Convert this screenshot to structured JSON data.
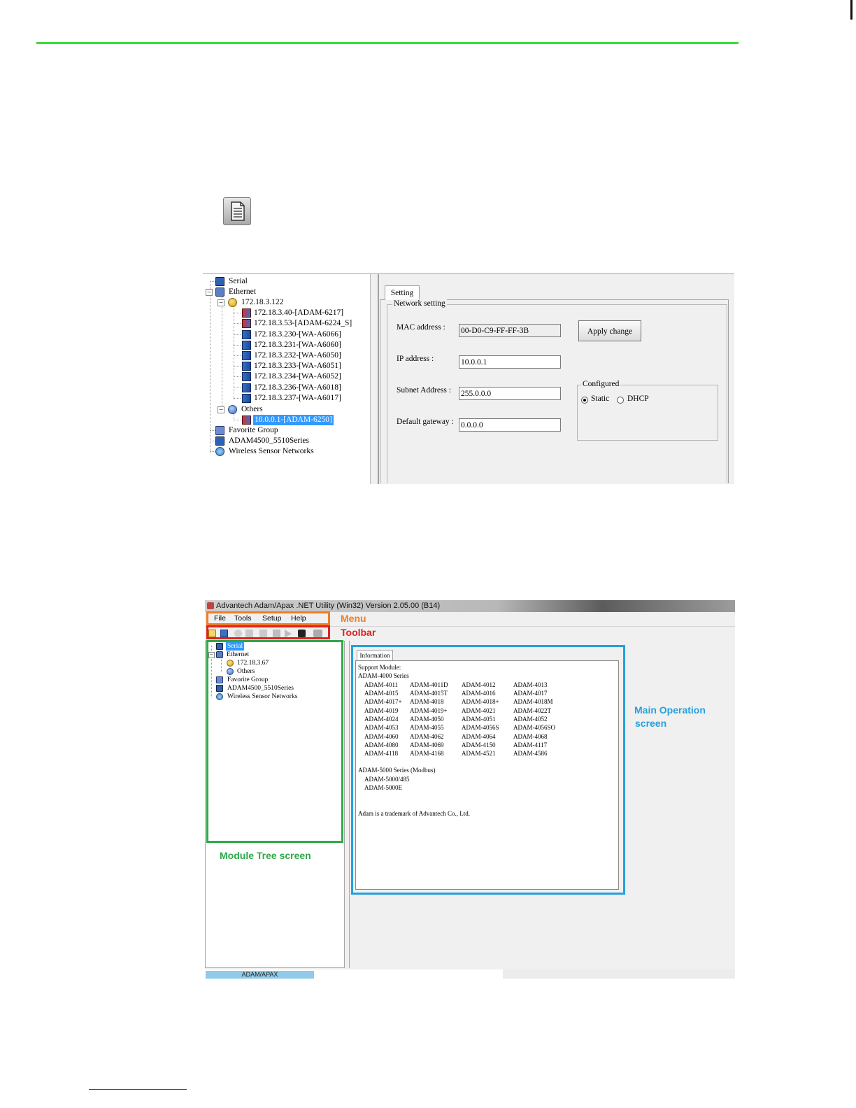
{
  "screenshot1": {
    "tree": [
      {
        "label": "Serial",
        "icon": "serial-pc-icon"
      },
      {
        "label": "Ethernet",
        "icon": "ethernet-icon"
      },
      {
        "label": "172.18.3.122",
        "icon": "subnet-globe-icon"
      },
      {
        "label": "172.18.3.40-[ADAM-6217]",
        "icon": "adam-module-icon"
      },
      {
        "label": "172.18.3.53-[ADAM-6224_S]",
        "icon": "adam-module-icon"
      },
      {
        "label": "172.18.3.230-[WA-A6066]",
        "icon": "wa-module-icon"
      },
      {
        "label": "172.18.3.231-[WA-A6060]",
        "icon": "wa-module-icon"
      },
      {
        "label": "172.18.3.232-[WA-A6050]",
        "icon": "wa-module-icon"
      },
      {
        "label": "172.18.3.233-[WA-A6051]",
        "icon": "wa-module-icon"
      },
      {
        "label": "172.18.3.234-[WA-A6052]",
        "icon": "wa-module-icon"
      },
      {
        "label": "172.18.3.236-[WA-A6018]",
        "icon": "wa-module-icon"
      },
      {
        "label": "172.18.3.237-[WA-A6017]",
        "icon": "wa-module-icon"
      },
      {
        "label": "Others",
        "icon": "others-icon"
      },
      {
        "label": "10.0.0.1-[ADAM-6250]",
        "icon": "adam-module-icon"
      },
      {
        "label": "Favorite Group",
        "icon": "favorite-icon"
      },
      {
        "label": "ADAM4500_5510Series",
        "icon": "adam4500-icon"
      },
      {
        "label": "Wireless Sensor Networks",
        "icon": "wireless-icon"
      }
    ],
    "tab": "Setting",
    "group_title": "Network setting",
    "mac_label": "MAC address :",
    "mac_value": "00-D0-C9-FF-FF-3B",
    "ip_label": "IP address :",
    "ip_value": "10.0.0.1",
    "subnet_label": "Subnet Address :",
    "subnet_value": "255.0.0.0",
    "gateway_label": "Default gateway :",
    "gateway_value": "0.0.0.0",
    "apply_button": "Apply change",
    "configured_title": "Configured",
    "static_label": "Static",
    "dhcp_label": "DHCP"
  },
  "screenshot2": {
    "window_title": "Advantech Adam/Apax .NET Utility (Win32) Version 2.05.00 (B14)",
    "menu": [
      "File",
      "Tools",
      "Setup",
      "Help"
    ],
    "tree": [
      "Serial",
      "Ethernet",
      "172.18.3.67",
      "Others",
      "Favorite Group",
      "ADAM4500_5510Series",
      "Wireless Sensor Networks"
    ],
    "tab": "Information",
    "info": {
      "support_heading": "Support Module:",
      "series4000": "ADAM-4000 Series",
      "modules4000": [
        [
          "ADAM-4011",
          "ADAM-4011D",
          "ADAM-4012",
          "ADAM-4013"
        ],
        [
          "ADAM-4015",
          "ADAM-4015T",
          "ADAM-4016",
          "ADAM-4017"
        ],
        [
          "ADAM-4017+",
          "ADAM-4018",
          "ADAM-4018+",
          "ADAM-4018M"
        ],
        [
          "ADAM-4019",
          "ADAM-4019+",
          "ADAM-4021",
          "ADAM-4022T"
        ],
        [
          "ADAM-4024",
          "ADAM-4050",
          "ADAM-4051",
          "ADAM-4052"
        ],
        [
          "ADAM-4053",
          "ADAM-4055",
          "ADAM-4056S",
          "ADAM-4056SO"
        ],
        [
          "ADAM-4060",
          "ADAM-4062",
          "ADAM-4064",
          "ADAM-4068"
        ],
        [
          "ADAM-4080",
          "ADAM-4069",
          "ADAM-4150",
          "ADAM-4117"
        ],
        [
          "ADAM-4118",
          "ADAM-4168",
          "ADAM-4521",
          "ADAM-4586"
        ]
      ],
      "series5000": "ADAM-5000 Series (Modbus)",
      "modules5000": [
        "ADAM-5000/485",
        "ADAM-5000E"
      ],
      "trademark": "Adam is a trademark of Advantech Co., Ltd."
    },
    "status_tab": "ADAM/APAX"
  },
  "callouts": {
    "menu": "Menu",
    "toolbar": "Toolbar",
    "module_tree": "Module Tree screen",
    "main_operation_line1": "Main Operation",
    "main_operation_line2": "screen"
  },
  "colors": {
    "page_rule": "#3ddc3d",
    "menu_frame": "#ee7d22",
    "toolbar_frame": "#e02020",
    "tree_frame": "#2ea84a",
    "main_frame": "#25a0dd",
    "selection": "#3399ff"
  }
}
